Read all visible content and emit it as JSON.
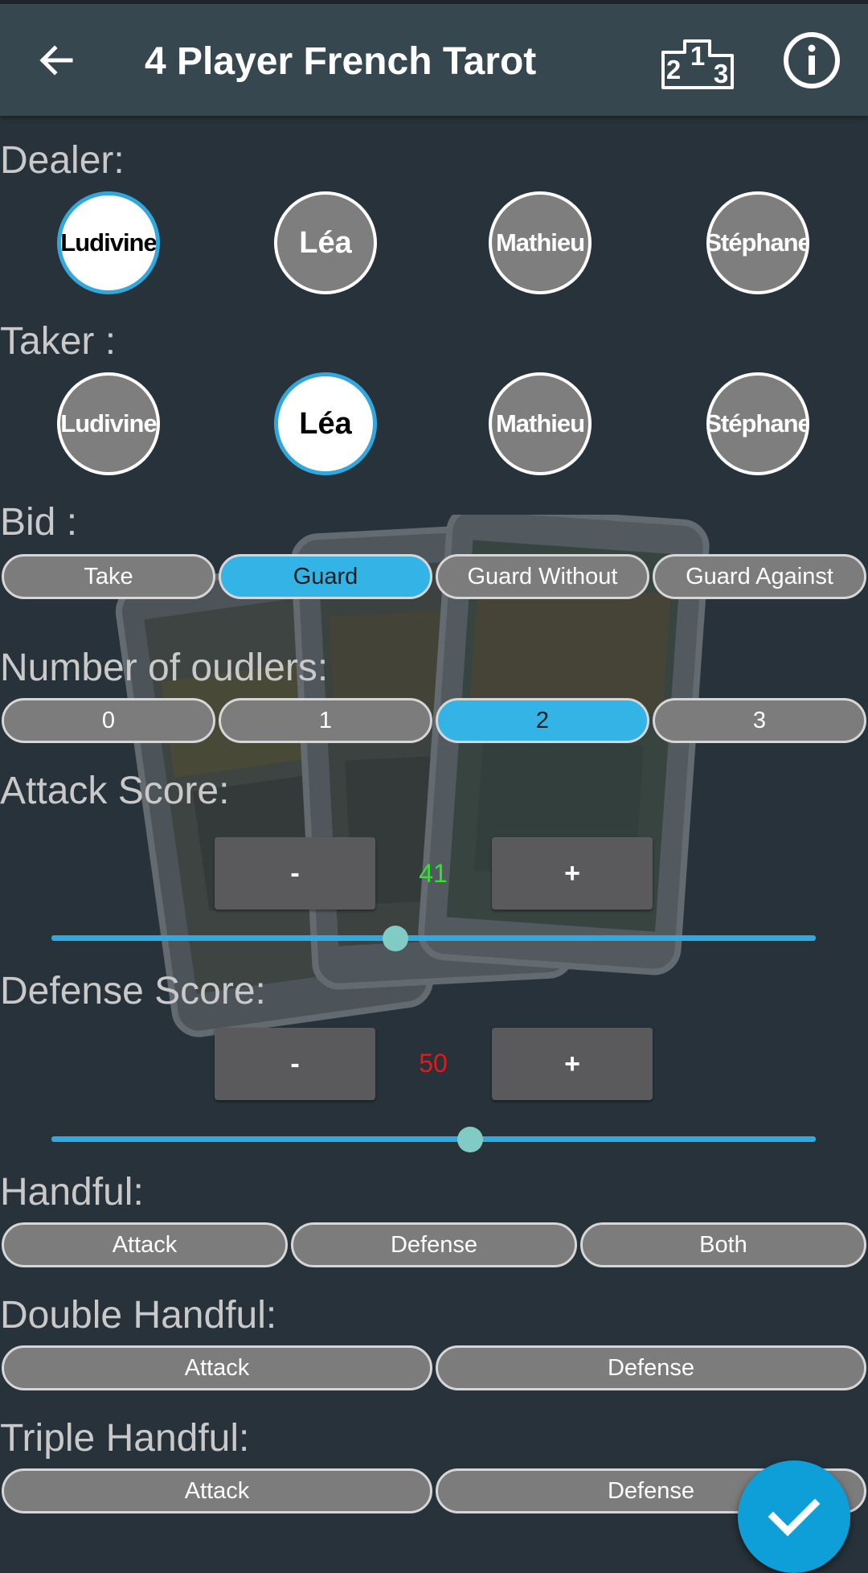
{
  "app_bar": {
    "title": "4 Player French Tarot",
    "back_icon": "arrow-left-icon",
    "ranking_icon": "podium-ranking-icon",
    "ranking_text": [
      "2",
      "1",
      "3"
    ],
    "info_icon": "info-icon"
  },
  "dealer": {
    "label": "Dealer:",
    "players": [
      "Ludivine",
      "Léa",
      "Mathieu",
      "Stéphane"
    ],
    "selected": "Ludivine"
  },
  "taker": {
    "label": "Taker :",
    "players": [
      "Ludivine",
      "Léa",
      "Mathieu",
      "Stéphane"
    ],
    "selected": "Léa"
  },
  "bid": {
    "label": "Bid :",
    "options": [
      "Take",
      "Guard",
      "Guard Without",
      "Guard Against"
    ],
    "selected": "Guard"
  },
  "oudlers": {
    "label": "Number of oudlers:",
    "options": [
      "0",
      "1",
      "2",
      "3"
    ],
    "selected": "2"
  },
  "attack_score": {
    "label": "Attack Score:",
    "minus": "-",
    "plus": "+",
    "value": "41",
    "color": "#31e331",
    "slider_fraction": 0.45
  },
  "defense_score": {
    "label": "Defense Score:",
    "minus": "-",
    "plus": "+",
    "value": "50",
    "color": "#e01b1b",
    "slider_fraction": 0.548
  },
  "handful": {
    "label": "Handful:",
    "options": [
      "Attack",
      "Defense",
      "Both"
    ]
  },
  "double_handful": {
    "label": "Double Handful:",
    "options": [
      "Attack",
      "Defense"
    ]
  },
  "triple_handful": {
    "label": "Triple Handful:",
    "options": [
      "Attack",
      "Defense"
    ]
  },
  "fab": {
    "icon": "checkmark-icon"
  },
  "colors": {
    "background": "#27323a",
    "app_bar": "#37474f",
    "accent": "#34b3e6",
    "fab": "#0f9fd8",
    "slider_thumb": "#80cbc4"
  }
}
